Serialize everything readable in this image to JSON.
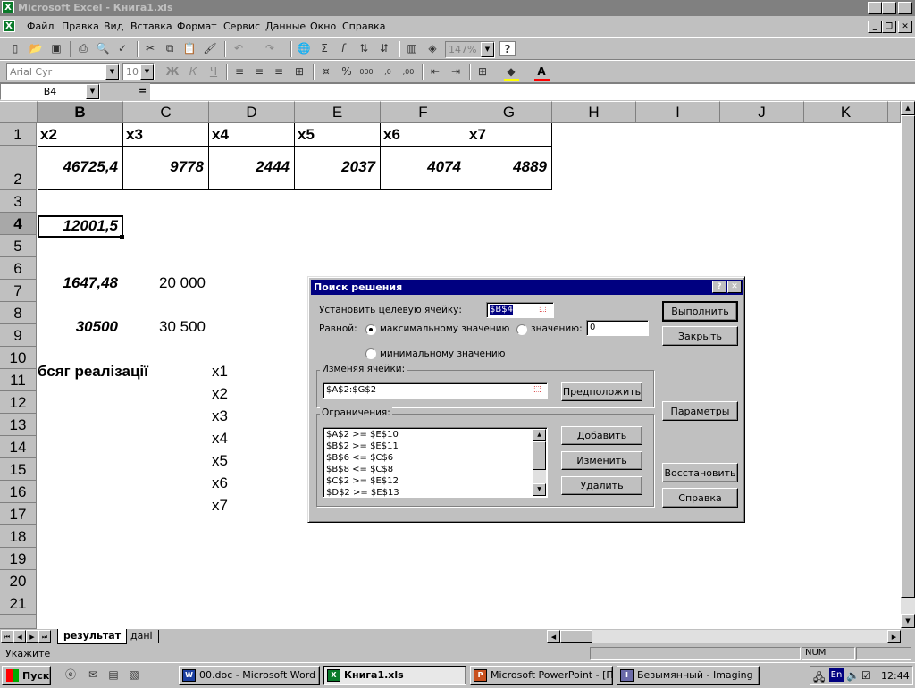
{
  "window": {
    "title": "Microsoft Excel - Книга1.xls"
  },
  "menu": {
    "items": [
      "Файл",
      "Правка",
      "Вид",
      "Вставка",
      "Формат",
      "Сервис",
      "Данные",
      "Окно",
      "Справка"
    ]
  },
  "toolbar": {
    "zoom": "147%",
    "font": "Arial Cyr",
    "size": "10"
  },
  "formula_bar": {
    "name_box": "B4",
    "equals": "="
  },
  "grid": {
    "columns": [
      "B",
      "C",
      "D",
      "E",
      "F",
      "G",
      "H",
      "I",
      "J",
      "K"
    ],
    "rows": [
      "1",
      "2",
      "3",
      "4",
      "5",
      "6",
      "7",
      "8",
      "9",
      "10",
      "11",
      "12",
      "13",
      "14",
      "15",
      "16",
      "17",
      "18",
      "19",
      "20",
      "21"
    ],
    "headers_row1": [
      "x2",
      "x3",
      "x4",
      "x5",
      "x6",
      "x7"
    ],
    "values_row2": [
      "46725,4",
      "9778",
      "2444",
      "2037",
      "4074",
      "4889"
    ],
    "b4": "12001,5",
    "b6": "1647,48",
    "c6": "20 000",
    "b8": "30500",
    "c8": "30 500",
    "a10": "бсяг реалізації",
    "d_labels": [
      "x1",
      "x2",
      "x3",
      "x4",
      "x5",
      "x6",
      "x7"
    ]
  },
  "dialog": {
    "title": "Поиск решения",
    "target_label": "Установить целевую ячейку:",
    "target_value": "$B$4",
    "equal_label": "Равной:",
    "opt_max": "максимальному значению",
    "opt_value": "значению:",
    "value_field": "0",
    "opt_min": "минимальному значению",
    "changing_label": "Изменяя ячейки:",
    "changing_value": "$A$2:$G$2",
    "guess_button": "Предположить",
    "constraints_label": "Ограничения:",
    "constraints": [
      "$A$2 >= $E$10",
      "$B$2 >= $E$11",
      "$B$6 <= $C$6",
      "$B$8 <= $C$8",
      "$C$2 >= $E$12",
      "$D$2 >= $E$13"
    ],
    "add_button": "Добавить",
    "change_button": "Изменить",
    "delete_button": "Удалить",
    "solve_button": "Выполнить",
    "close_button": "Закрыть",
    "options_button": "Параметры",
    "reset_button": "Восстановить",
    "help_button": "Справка",
    "help_icon": "?",
    "close_icon": "✕"
  },
  "sheets": {
    "tabs": [
      "результат",
      "дані"
    ]
  },
  "status": {
    "text": "Укажите",
    "num": "NUM"
  },
  "taskbar": {
    "start": "Пуск",
    "tasks": [
      "00.doc - Microsoft Word",
      "Книга1.xls",
      "Microsoft PowerPoint - [Пр...",
      "Безымянный - Imaging"
    ],
    "lang": "En",
    "clock": "12:44"
  },
  "colors": {
    "title_active": "#000080",
    "title_inactive": "#808080",
    "face": "#c0c0c0"
  }
}
